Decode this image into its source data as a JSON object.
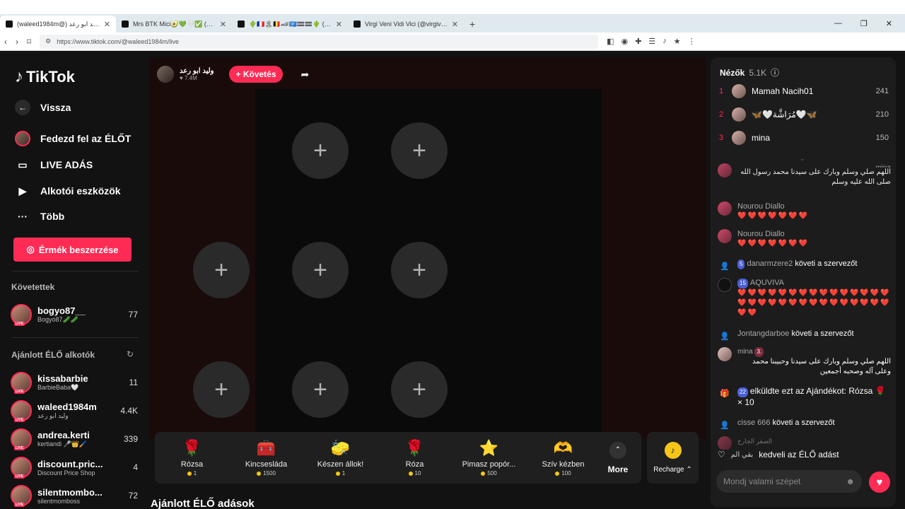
{
  "browser": {
    "tabs": [
      {
        "title": "(waleed1984m@) وليد ابو رعد",
        "active": true
      },
      {
        "title": "Mrs BTK Mici🥑💚🤍✅ (@mrsbtk) |",
        "active": false
      },
      {
        "title": "🌵🇨🇵🏝🇧🇪🏎🇸🇴🟰🟰🌵 (@csby01)",
        "active": false
      },
      {
        "title": "Virgi Veni Vidi Vici (@virgivenividivici)",
        "active": false
      }
    ],
    "url": "https://www.tiktok.com/@waleed1984m/live",
    "win": [
      "—",
      "❐",
      "✕"
    ]
  },
  "sidebar": {
    "logo": "TikTok",
    "back": "Vissza",
    "nav": [
      "Fedezd fel az ÉLŐT",
      "LIVE ADÁS",
      "Alkotói eszközök",
      "Több"
    ],
    "coins_button": "Érmék beszerzése",
    "following_title": "Követettek",
    "following": [
      {
        "name": "bogyo87__",
        "sub": "Bogyó87🥒🥒",
        "count": "77"
      }
    ],
    "recommended_title": "Ajánlott ÉLŐ alkotók",
    "recommended": [
      {
        "name": "kissabarbie",
        "sub": "BarbieBaba🤍",
        "count": "11"
      },
      {
        "name": "waleed1984m",
        "sub": "وليد ابو رعد",
        "count": "4.4K"
      },
      {
        "name": "andrea.kerti",
        "sub": "kertiandi 🎤👑🖌️",
        "count": "339"
      },
      {
        "name": "discount.pric...",
        "sub": "Discount Price Shop",
        "count": "4"
      },
      {
        "name": "silentmombo...",
        "sub": "silentmomboss",
        "count": "72"
      }
    ]
  },
  "host": {
    "name": "وليد ابو رعد",
    "likes": "7.4M",
    "follow": "+ Követés"
  },
  "gifts": [
    {
      "name": "Rózsa",
      "price": "1",
      "icon": "🌹"
    },
    {
      "name": "Kincsesláda",
      "price": "1500",
      "icon": "🧰"
    },
    {
      "name": "Készen állok!",
      "price": "1",
      "icon": "🧽"
    },
    {
      "name": "Róza",
      "price": "10",
      "icon": "🌹"
    },
    {
      "name": "Pimasz popór...",
      "price": "500",
      "icon": "⭐"
    },
    {
      "name": "Szív kézben",
      "price": "100",
      "icon": "🫶"
    }
  ],
  "more": "More",
  "recharge": "Recharge",
  "bottom_title": "Ajánlott ÉLŐ adások",
  "chat": {
    "viewers_label": "Nézők",
    "viewers_count": "5.1K",
    "top": [
      {
        "rank": "1",
        "name": "Mamah Nacih01",
        "score": "241"
      },
      {
        "rank": "2",
        "name": "🦋🤍مُرَاشَّة🤍🦋",
        "score": "210"
      },
      {
        "rank": "3",
        "name": "mina",
        "score": "150"
      }
    ],
    "messages": {
      "m1_name": "mina",
      "m1_text": "اللهم صلي وسلم وبارك على سيدنا محمد رسول الله صلى الله عليه وسلم",
      "m2_name": "Nourou Diallo",
      "m2_text": "❤️❤️❤️❤️❤️❤️❤️",
      "m3_name": "Nourou Diallo",
      "m3_text": "❤️❤️❤️❤️❤️❤️❤️",
      "m4_badge": "5",
      "m4_name": "danarmzere2",
      "m4_text": "követi a szervezőt",
      "m5_badge": "15",
      "m5_name": "AQUVIVA",
      "m5_text": "❤️❤️❤️❤️❤️❤️❤️❤️❤️❤️❤️❤️❤️❤️❤️❤️❤️❤️❤️❤️❤️❤️❤️❤️❤️❤️❤️❤️❤️❤️❤️❤️",
      "m6_name": "Jontangdarboe",
      "m6_text": "követi a szervezőt",
      "m7_name": "mina",
      "m7_badge": "3.",
      "m7_text": "اللهم صلي وسلم وبارك على سيدنا وحبيبنا محمد وعلى آله وصحبه أجمعين",
      "m8_badge": "22",
      "m8_text": "elküldte ezt az Ajándékot: Rózsa 🌹 × 10",
      "m9_name": "cisse 666",
      "m9_text": "követi a szervezőt",
      "m10_name": "الصقر الجارح"
    },
    "like_name": "بقي الم",
    "like_text": "kedveli az ÉLŐ adást",
    "input_placeholder": "Mondj valami szépet"
  }
}
